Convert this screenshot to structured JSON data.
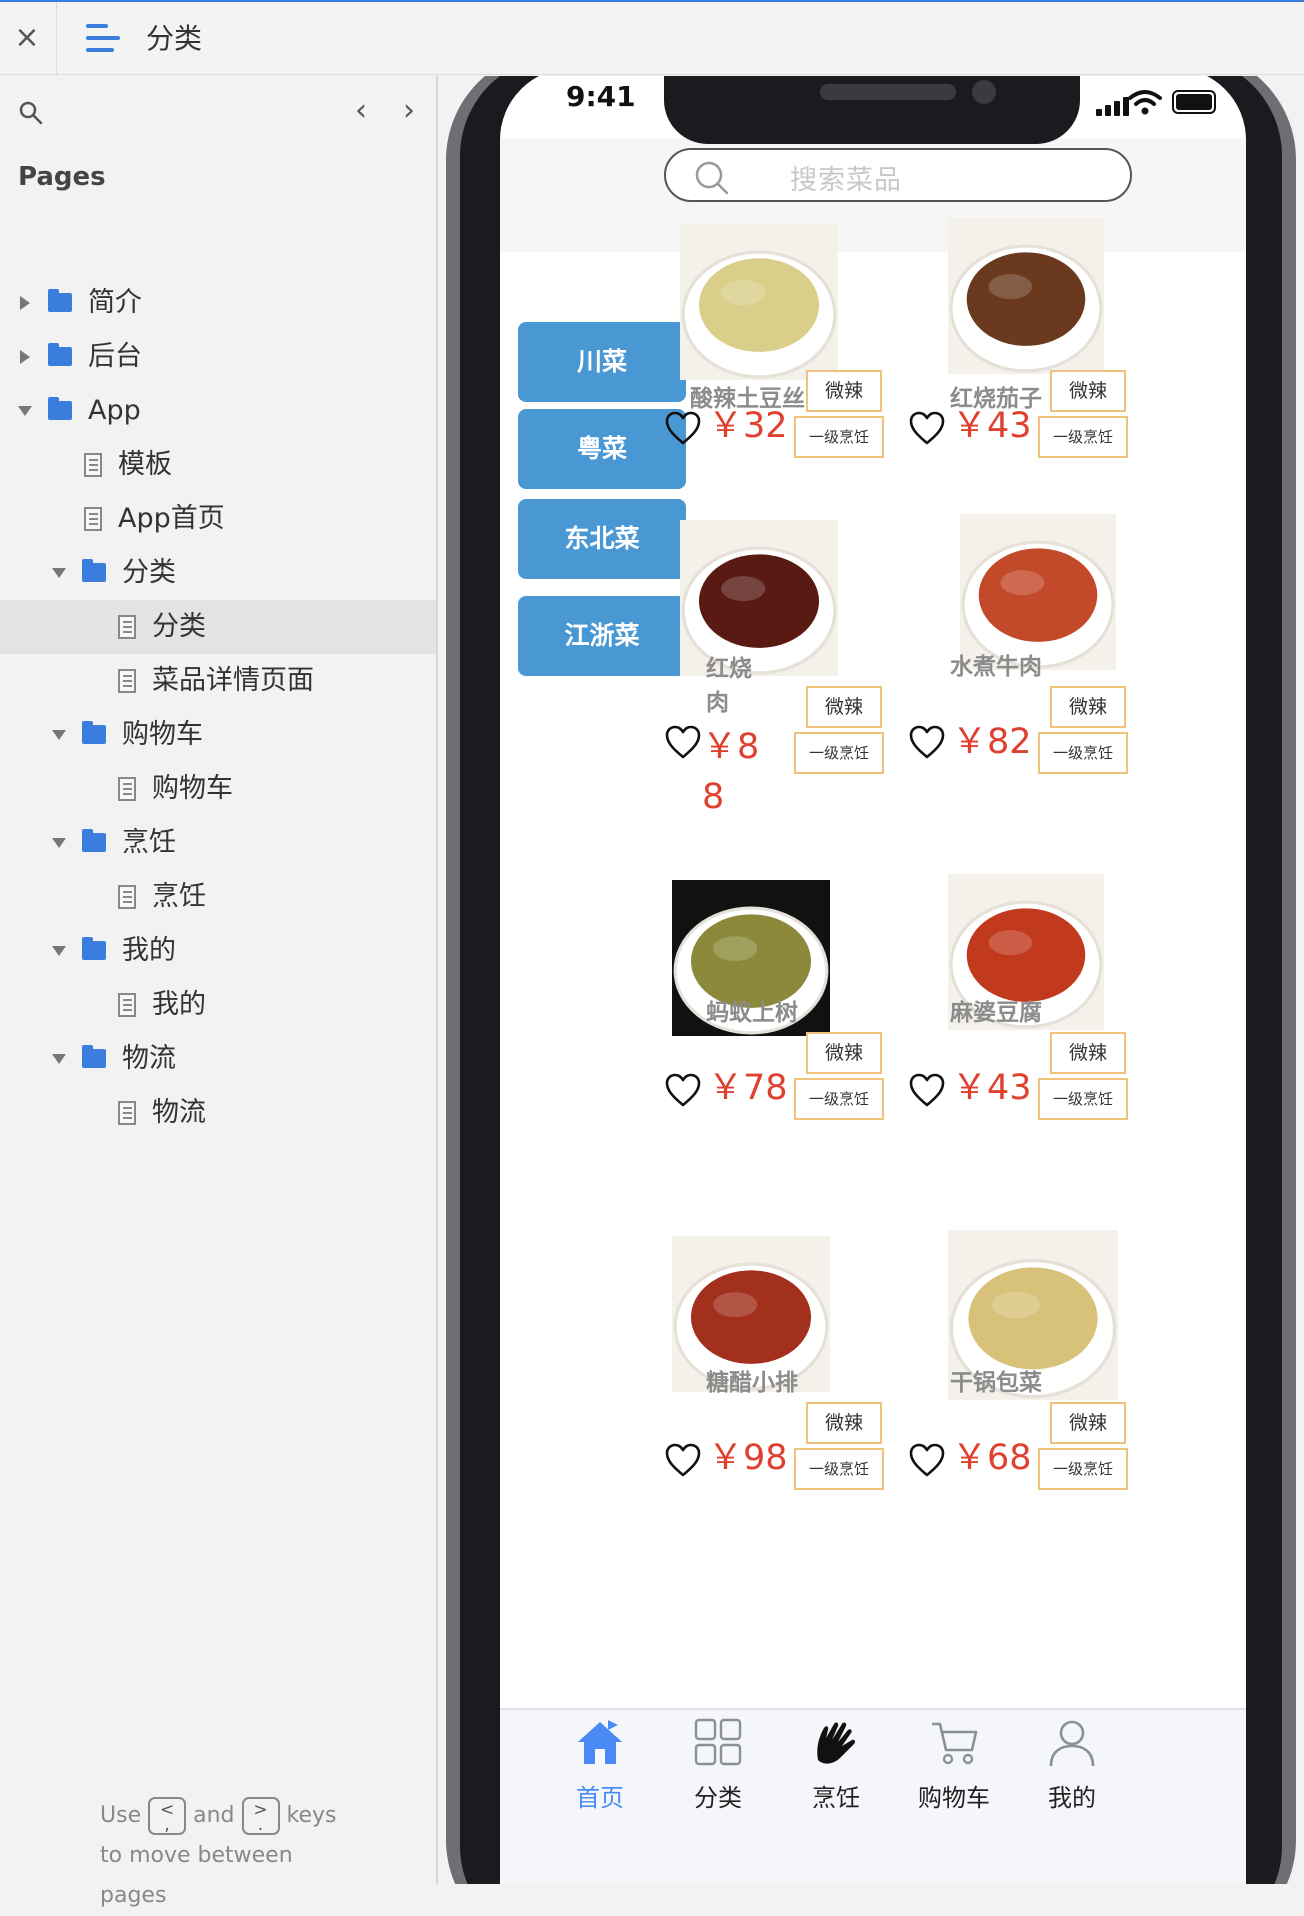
{
  "topbar": {
    "close": "×",
    "title": "分类"
  },
  "sidebar": {
    "heading": "Pages",
    "prev": "‹",
    "next": "›",
    "tree": [
      {
        "label": "简介",
        "type": "folder",
        "expanded": false,
        "depth": 0
      },
      {
        "label": "后台",
        "type": "folder",
        "expanded": false,
        "depth": 0
      },
      {
        "label": "App",
        "type": "folder",
        "expanded": true,
        "depth": 0
      },
      {
        "label": "模板",
        "type": "page",
        "depth": 1
      },
      {
        "label": "App首页",
        "type": "page",
        "depth": 1
      },
      {
        "label": "分类",
        "type": "folder",
        "expanded": true,
        "depth": 1
      },
      {
        "label": "分类",
        "type": "page",
        "depth": 2,
        "selected": true
      },
      {
        "label": "菜品详情页面",
        "type": "page",
        "depth": 2
      },
      {
        "label": "购物车",
        "type": "folder",
        "expanded": true,
        "depth": 1
      },
      {
        "label": "购物车",
        "type": "page",
        "depth": 2
      },
      {
        "label": "烹饪",
        "type": "folder",
        "expanded": true,
        "depth": 1
      },
      {
        "label": "烹饪",
        "type": "page",
        "depth": 2
      },
      {
        "label": "我的",
        "type": "folder",
        "expanded": true,
        "depth": 1
      },
      {
        "label": "我的",
        "type": "page",
        "depth": 2
      },
      {
        "label": "物流",
        "type": "folder",
        "expanded": true,
        "depth": 1
      },
      {
        "label": "物流",
        "type": "page",
        "depth": 2
      }
    ],
    "hint": {
      "use": "Use",
      "and": "and",
      "keys": "keys",
      "line2": "to move between pages",
      "key_prev_top": "<",
      "key_prev_bottom": ",",
      "key_next_top": ">",
      "key_next_bottom": "."
    }
  },
  "phone": {
    "time": "9:41",
    "search_placeholder": "搜索菜品",
    "categories": [
      "川菜",
      "粤菜",
      "东北菜",
      "江浙菜"
    ],
    "dishes": [
      {
        "name": "酸辣土豆丝",
        "price": "￥32",
        "spicy": "微辣",
        "level": "一级烹饪",
        "color": "#d9cf8a"
      },
      {
        "name": "红烧茄子",
        "price": "￥43",
        "spicy": "微辣",
        "level": "一级烹饪",
        "color": "#6b3a1e"
      },
      {
        "name": "红烧肉",
        "price": "￥88",
        "spicy": "微辣",
        "level": "一级烹饪",
        "color": "#5a1a14"
      },
      {
        "name": "水煮牛肉",
        "price": "￥82",
        "spicy": "微辣",
        "level": "一级烹饪",
        "color": "#c24a2a"
      },
      {
        "name": "蚂蚁上树",
        "price": "￥78",
        "spicy": "微辣",
        "level": "一级烹饪",
        "color": "#8c8a3a"
      },
      {
        "name": "麻婆豆腐",
        "price": "￥43",
        "spicy": "微辣",
        "level": "一级烹饪",
        "color": "#c23a1e"
      },
      {
        "name": "糖醋小排",
        "price": "￥98",
        "spicy": "微辣",
        "level": "一级烹饪",
        "color": "#a3301c"
      },
      {
        "name": "干锅包菜",
        "price": "￥68",
        "spicy": "微辣",
        "level": "一级烹饪",
        "color": "#d8c27a"
      }
    ],
    "tabs": [
      {
        "label": "首页",
        "icon": "home-icon",
        "active": true
      },
      {
        "label": "分类",
        "icon": "grid-icon",
        "active": false
      },
      {
        "label": "烹饪",
        "icon": "hands-icon",
        "active": false
      },
      {
        "label": "购物车",
        "icon": "cart-icon",
        "active": false
      },
      {
        "label": "我的",
        "icon": "user-icon",
        "active": false
      }
    ],
    "colors": {
      "accent": "#4a98d3",
      "price": "#e0402f",
      "tag_border": "#f1c27d",
      "tab_active": "#4a8af4"
    }
  }
}
